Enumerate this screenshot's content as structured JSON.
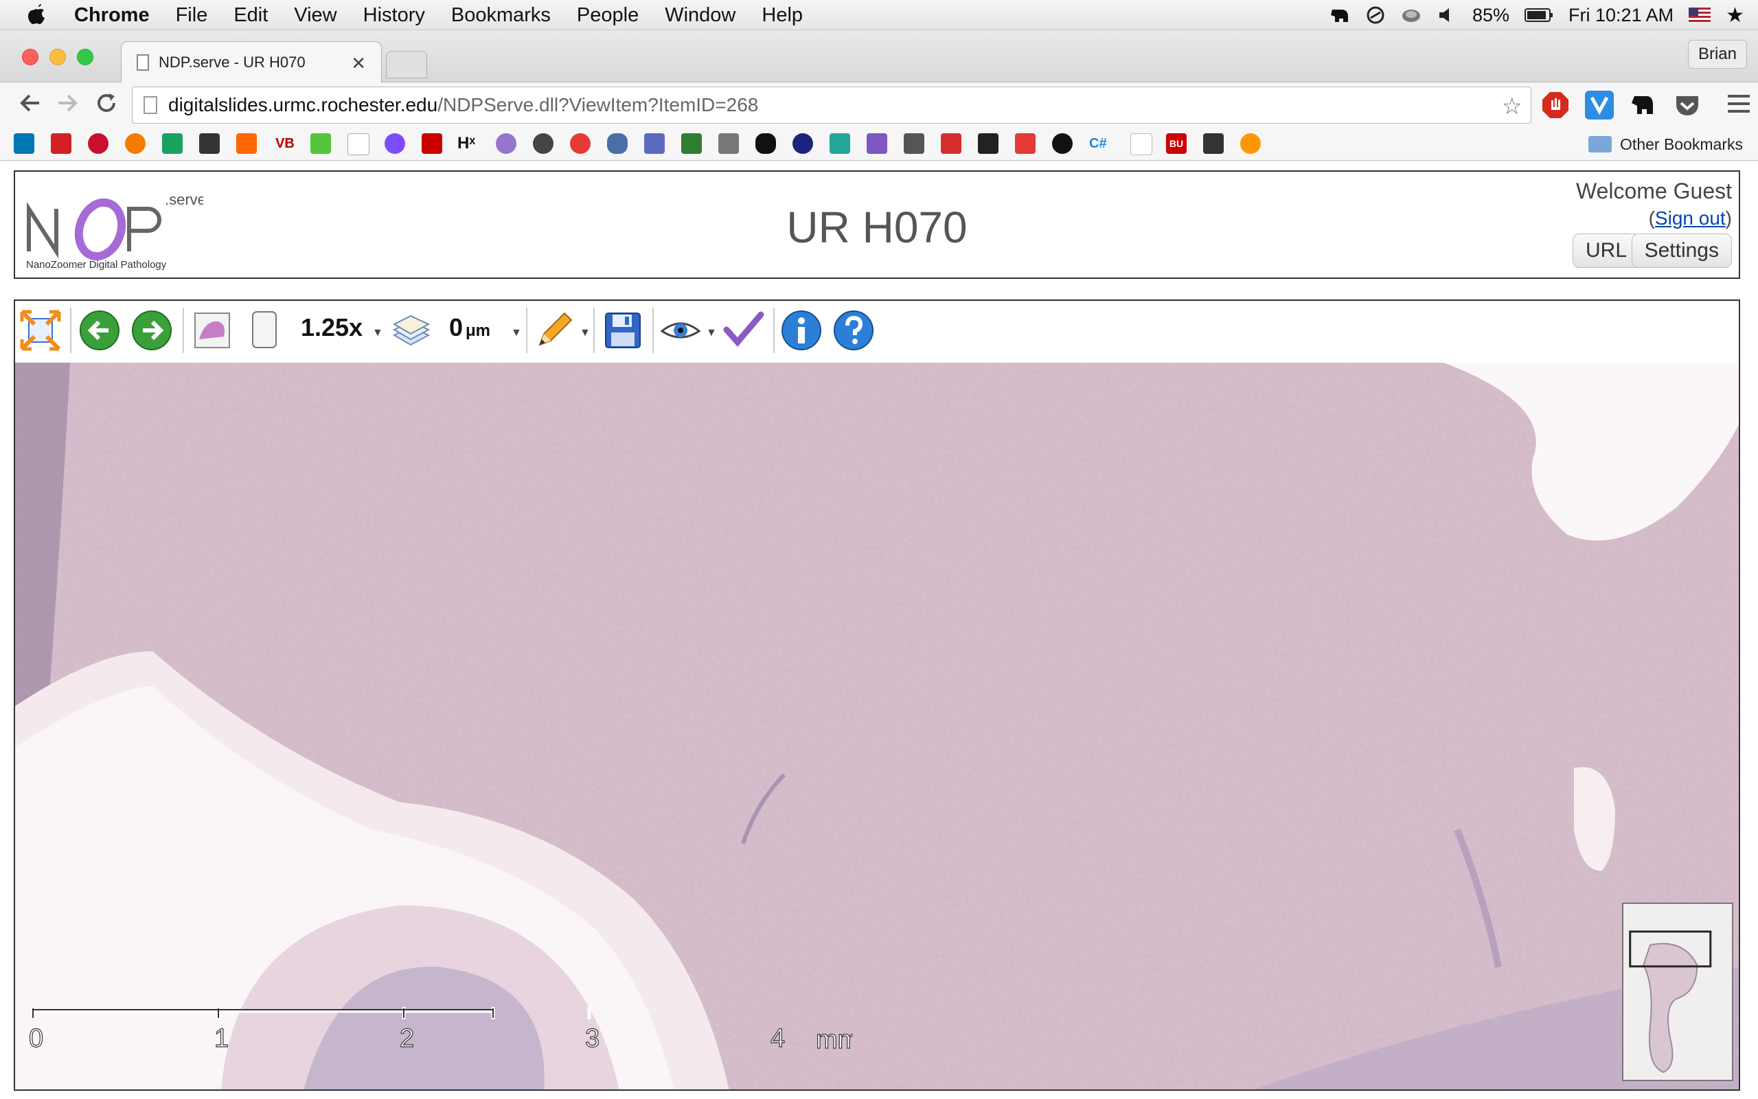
{
  "menubar": {
    "app_name": "Chrome",
    "menus": [
      "File",
      "Edit",
      "View",
      "History",
      "Bookmarks",
      "People",
      "Window",
      "Help"
    ],
    "battery": "85%",
    "clock": "Fri 10:21 AM"
  },
  "browser": {
    "tab_title": "NDP.serve - UR H070",
    "profile_name": "Brian",
    "url_host": "digitalslides.urmc.rochester.edu",
    "url_path": "/NDPServe.dll?ViewItem?ItemID=268",
    "bookmarks_labels": [
      "Hˣ",
      "VB",
      "C#",
      "BU"
    ],
    "other_bookmarks": "Other Bookmarks"
  },
  "page": {
    "logo_serve": ".serve",
    "logo_tagline": "NanoZoomer Digital Pathology",
    "slide_title": "UR H070",
    "welcome": "Welcome Guest",
    "signout_open": "(",
    "signout_link": "Sign out",
    "signout_close": ")",
    "url_button": "URL",
    "settings_button": "Settings"
  },
  "viewer": {
    "magnification": "1.25x",
    "focus_value": "0",
    "focus_unit": "μm",
    "scale_ticks": [
      "0",
      "1",
      "2",
      "3",
      "4"
    ],
    "scale_unit": "mm"
  },
  "colors": {
    "tissue": "#d9c3ce",
    "tissue_dark": "#c9aebf",
    "accent_purple": "#a66bd6"
  }
}
